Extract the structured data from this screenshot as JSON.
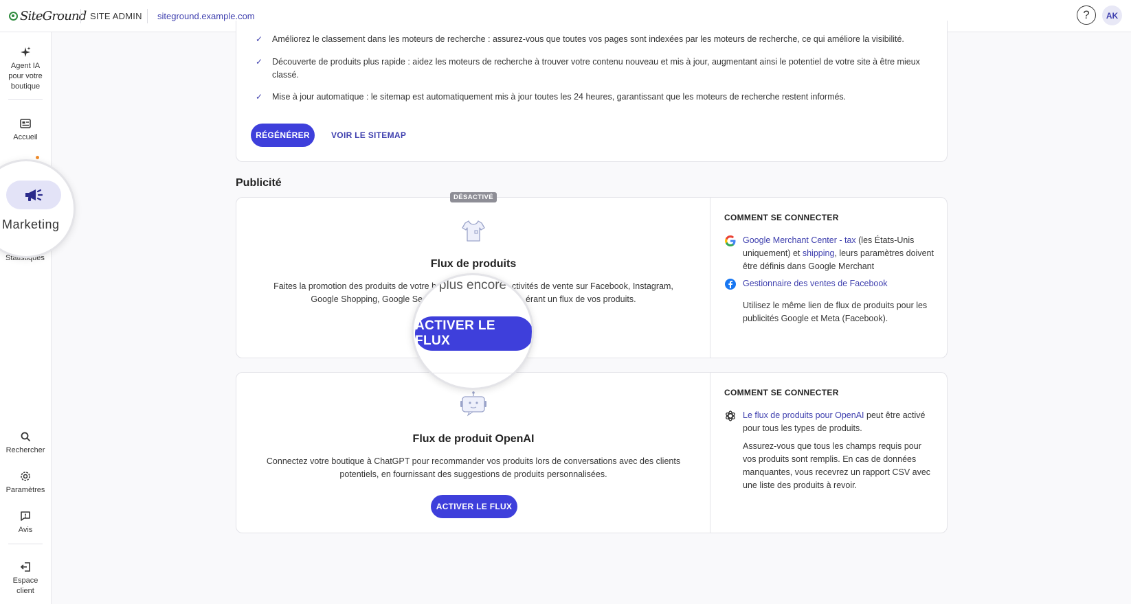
{
  "topbar": {
    "logo": "SiteGround",
    "site_admin": "SITE ADMIN",
    "domain": "siteground.example.com",
    "help": "?",
    "avatar": "AK"
  },
  "sidebar": {
    "ai_agent": "Agent IA pour votre boutique",
    "home": "Accueil",
    "marketing": "Marketing",
    "stats_partial": "Statistiques",
    "search": "Rechercher",
    "settings": "Paramètres",
    "feedback": "Avis",
    "client_area": "Espace client"
  },
  "sitemap": {
    "bullets": [
      "Améliorez le classement dans les moteurs de recherche : assurez-vous que toutes vos pages sont indexées par les moteurs de recherche, ce qui améliore la visibilité.",
      "Découverte de produits plus rapide : aidez les moteurs de recherche à trouver votre contenu nouveau et mis à jour, augmentant ainsi le potentiel de votre site à être mieux classé.",
      "Mise à jour automatique : le sitemap est automatiquement mis à jour toutes les 24 heures, garantissant que les moteurs de recherche restent informés."
    ],
    "regenerate": "RÉGÉNÉRER",
    "view_sitemap": "VOIR LE SITEMAP"
  },
  "ads": {
    "section_title": "Publicité",
    "disabled_badge": "DÉSACTIVÉ",
    "product_feed": {
      "title": "Flux de produits",
      "desc_line1": "Faites la promotion des produits de votre b",
      "desc_line1_end": "ctivités de vente sur Facebook, Instagram,",
      "desc_line2": "Google Shopping, Google Se",
      "desc_line2_end": "érant un flux de vos produits.",
      "lens_text": "plus encore",
      "activate": "ACTIVER LE FLUX",
      "howto_title": "COMMENT SE CONNECTER",
      "google_link": "Google Merchant Center - tax",
      "google_text1": " (les États-Unis uniquement) et ",
      "google_shipping": "shipping",
      "google_text2": ", leurs paramètres doivent être définis dans Google Merchant",
      "facebook_link": "Gestionnaire des ventes de Facebook",
      "same_link_note": "Utilisez le même lien de flux de produits pour les publicités Google et Meta (Facebook)."
    },
    "openai_feed": {
      "title": "Flux de produit OpenAI",
      "desc": "Connectez votre boutique à ChatGPT pour recommander vos produits lors de conversations avec des clients potentiels, en fournissant des suggestions de produits personnalisées.",
      "activate": "ACTIVER LE FLUX",
      "howto_title": "COMMENT SE CONNECTER",
      "openai_link": "Le flux de produits pour OpenAI",
      "openai_text": " peut être activé pour tous les types de produits.",
      "fields_note": "Assurez-vous que tous les champs requis pour vos produits sont remplis. En cas de données manquantes, vous recevrez un rapport CSV avec une liste des produits à revoir."
    }
  },
  "colors": {
    "accent": "#3e3fdb",
    "link": "#3e3fae",
    "brand_green": "#2e8b3d",
    "notice_dot": "#f08c2c"
  }
}
